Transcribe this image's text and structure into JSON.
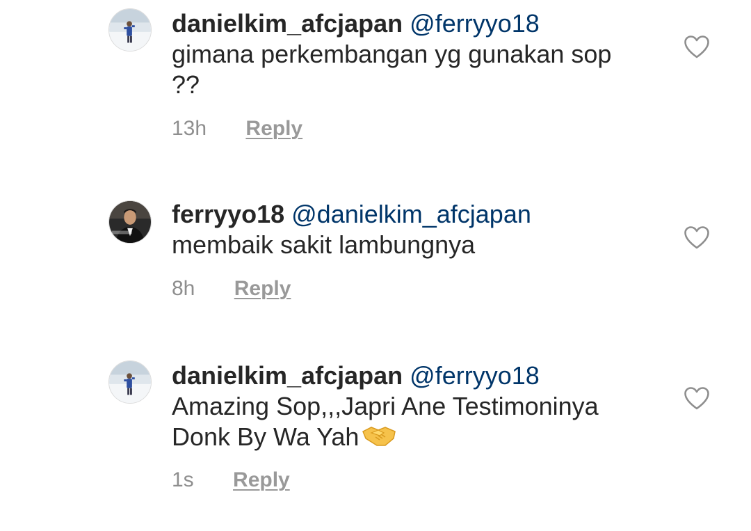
{
  "comments": [
    {
      "username": "danielkim_afcjapan",
      "mention": "@ferryyo18",
      "text": "gimana perkembangan yg gunakan sop ??",
      "time": "13h",
      "reply_label": "Reply",
      "avatar_icon": "avatar-person-snow",
      "like_icon": "heart-outline-icon"
    },
    {
      "username": "ferryyo18",
      "mention": "@danielkim_afcjapan",
      "text": "membaik sakit lambungnya",
      "time": "8h",
      "reply_label": "Reply",
      "avatar_icon": "avatar-person-suit",
      "like_icon": "heart-outline-icon"
    },
    {
      "username": "danielkim_afcjapan",
      "mention": "@ferryyo18",
      "text": "Amazing Sop,,,Japri Ane Testimoninya Donk By Wa Yah",
      "emoji": "handshake-emoji",
      "time": "1s",
      "reply_label": "Reply",
      "avatar_icon": "avatar-person-snow",
      "like_icon": "heart-outline-icon"
    }
  ],
  "colors": {
    "username": "#262626",
    "mention": "#003569",
    "meta": "#8e8e8e",
    "reply": "#999999",
    "heart_stroke": "#8e8e8e"
  }
}
